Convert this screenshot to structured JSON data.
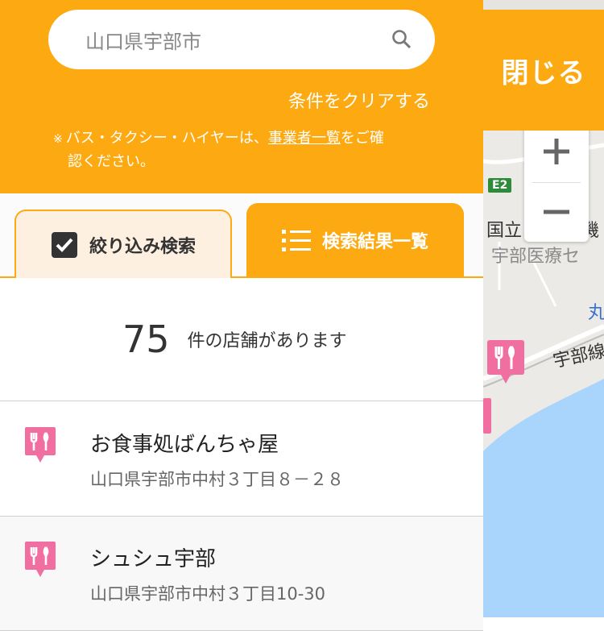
{
  "search": {
    "value": "山口県宇部市"
  },
  "header": {
    "clear_label": "条件をクリアする",
    "notice_mark": "※",
    "notice_before": "バス・タクシー・ハイヤーは、",
    "notice_link": "事業者一覧",
    "notice_after": "をご確",
    "notice_line2": "認ください。"
  },
  "tabs": {
    "filter_label": "絞り込み検索",
    "results_label": "検索結果一覧"
  },
  "results": {
    "count": "75",
    "count_suffix": "件の店舗があります"
  },
  "shops": [
    {
      "name": "お食事処ばんちゃ屋",
      "address": "山口県宇部市中村３丁目８－２８"
    },
    {
      "name": "シュシュ宇部",
      "address": "山口県宇部市中村３丁目10-30"
    }
  ],
  "map": {
    "close_label": "閉じる",
    "route_badge": "E2",
    "labels": [
      "国立",
      "機",
      "宇部医療セ",
      "丸",
      "宇部線"
    ]
  },
  "colors": {
    "accent": "#fca912",
    "pin": "#f06ea0",
    "sea": "#a9d4fb"
  }
}
